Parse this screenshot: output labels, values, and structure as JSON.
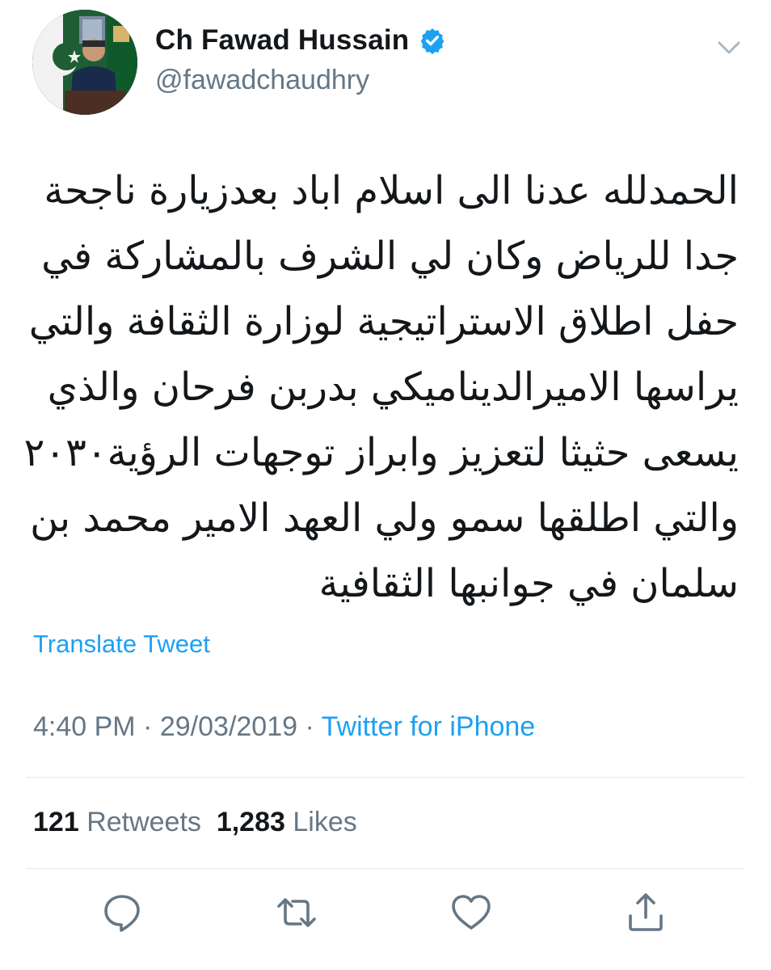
{
  "user": {
    "name": "Ch Fawad Hussain",
    "handle": "@fawadchaudhry",
    "verified": true
  },
  "tweet": {
    "lines": [
      "الحمدلله عدنا الى اسلام اباد بعدزيارة ناجحة",
      "جدا للرياض وكان لي الشرف بالمشاركة في",
      "حفل اطلاق الاستراتيجية  لوزارة الثقافة والتي",
      "يراسها الاميرالديناميكي بدربن فرحان والذي",
      "يسعى حثيثا لتعزيز وابراز توجهات الرؤية٢٠٣٠",
      "والتي اطلقها سمو ولي العهد الامير محمد بن",
      "سلمان في جوانبها الثقافية"
    ],
    "translate_label": "Translate Tweet",
    "time": "4:40 PM",
    "date": "29/03/2019",
    "separator": "·",
    "source": "Twitter for iPhone"
  },
  "stats": {
    "retweets_count": "121",
    "retweets_label": "Retweets",
    "likes_count": "1,283",
    "likes_label": "Likes"
  },
  "icons": {
    "menu": "chevron-down-icon",
    "verified": "verified-badge-icon",
    "reply": "reply-icon",
    "retweet": "retweet-icon",
    "like": "heart-icon",
    "share": "share-icon"
  },
  "colors": {
    "accent": "#1da1f2",
    "secondary_text": "#657786",
    "divider": "#e1e8ed",
    "text": "#14171a"
  }
}
